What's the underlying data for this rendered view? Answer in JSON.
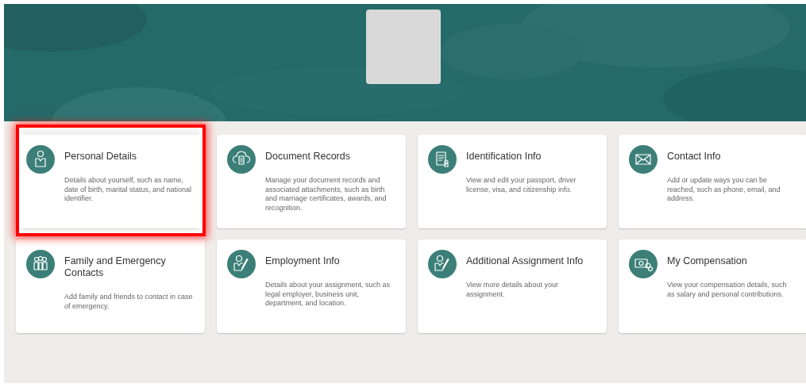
{
  "tiles": [
    {
      "title": "Personal Details",
      "description": "Details about yourself, such as name, date of birth, marital status, and national identifier.",
      "highlighted": true
    },
    {
      "title": "Document Records",
      "description": "Manage your document records and associated attachments, such as birth and marriage certificates, awards, and recognition.",
      "highlighted": false
    },
    {
      "title": "Identification Info",
      "description": "View and edit your passport, driver license, visa, and citizenship info.",
      "highlighted": false
    },
    {
      "title": "Contact Info",
      "description": "Add or update ways you can be reached, such as phone, email, and address.",
      "highlighted": false
    },
    {
      "title": "Family and Emergency Contacts",
      "description": "Add family and friends to contact in case of emergency.",
      "highlighted": false
    },
    {
      "title": "Employment Info",
      "description": "Details about your assignment, such as legal employer, business unit, department, and location.",
      "highlighted": false
    },
    {
      "title": "Additional Assignment Info",
      "description": "View more details about your assignment.",
      "highlighted": false
    },
    {
      "title": "My Compensation",
      "description": "View your compensation details, such as salary and personal contributions.",
      "highlighted": false
    }
  ]
}
